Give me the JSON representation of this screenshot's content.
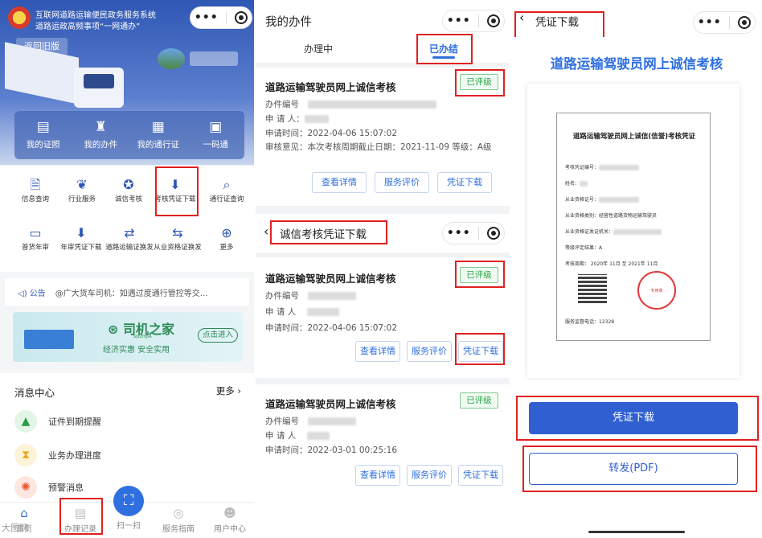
{
  "panel1": {
    "title_line1": "互联网道路运输便民政务服务系统",
    "title_line2": "道路运政高频事项“一网通办”",
    "back_old": "返回旧版",
    "quick": [
      {
        "label": "我的证照",
        "icon": "id-card-icon"
      },
      {
        "label": "我的办件",
        "icon": "stamp-icon"
      },
      {
        "label": "我的通行证",
        "icon": "pass-icon"
      },
      {
        "label": "一码通",
        "icon": "qr-icon"
      }
    ],
    "grid": [
      {
        "label": "信息查询",
        "icon": "search-doc-icon"
      },
      {
        "label": "行业服务",
        "icon": "hands-icon"
      },
      {
        "label": "诚信考核",
        "icon": "medal-icon"
      },
      {
        "label": "考核凭证下载",
        "icon": "download-doc-icon"
      },
      {
        "label": "通行证查询",
        "icon": "pass-search-icon"
      },
      {
        "label": "普货年审",
        "icon": "calendar-icon"
      },
      {
        "label": "年审凭证下载",
        "icon": "download-icon"
      },
      {
        "label": "道路运输证换发",
        "icon": "card-swap-icon"
      },
      {
        "label": "从业资格证换发",
        "icon": "license-swap-icon"
      },
      {
        "label": "更多",
        "icon": "plus-icon"
      }
    ],
    "notice_tag": "公告",
    "notice_text": "@广大货车司机：如遇过度通行管控等交…",
    "banner_logo": "司机之家",
    "banner_logo_sub": "SIJIZHIJIA",
    "banner_sub": "经济实惠 安全实用",
    "banner_btn": "点击进入",
    "msg_title": "消息中心",
    "msg_more": "更多",
    "msg_items": [
      "证件到期提醒",
      "业务办理进度",
      "预警消息"
    ],
    "tabs": [
      "首页",
      "办理记录",
      "扫一扫",
      "服务指南",
      "用户中心"
    ],
    "watermark": "大图网"
  },
  "panel2": {
    "title": "我的办件",
    "tab_processing": "办理中",
    "tab_done": "已办结",
    "card_title": "道路运输驾驶员网上诚信考核",
    "badge": "已评级",
    "label_no": "办件编号",
    "label_applicant": "申 请 人",
    "card1_time": "申请时间：2022-04-06 15:07:02",
    "card1_opinion": "审核意见：本次考核周期截止日期：2021-11-09 等级：A级",
    "btn_detail": "查看详情",
    "btn_eval": "服务评价",
    "btn_download": "凭证下载",
    "nav_title": "诚信考核凭证下载",
    "card2_time": "申请时间：2022-04-06 15:07:02",
    "card3_time": "申请时间：2022-03-01 00:25:16"
  },
  "panel3": {
    "nav_title": "凭证下载",
    "heading": "道路运输驾驶员网上诚信考核",
    "cert_title": "道路运输驾驶员网上诚信(信誉)考核凭证",
    "cert_rows": [
      "考核凭证编号：",
      "姓名：",
      "从业资格证号：",
      "从业资格类别：经营性道路货物运输驾驶员",
      "从业资格证发证机关：",
      "等级评定结果：A",
      "考核周期：  2020年 11月  至 2021年 11月"
    ],
    "cert_phone": "服务监督电话：12328",
    "seal_text": "专用章",
    "btn_download": "凭证下载",
    "btn_forward": "转发(PDF)"
  }
}
